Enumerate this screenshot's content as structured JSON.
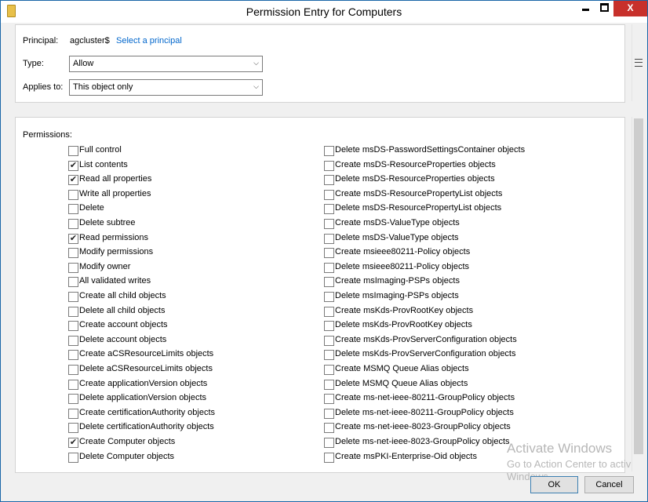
{
  "window": {
    "title": "Permission Entry for Computers",
    "close_glyph": "X"
  },
  "principal": {
    "label": "Principal:",
    "value": "agcluster$",
    "link": "Select a principal"
  },
  "type": {
    "label": "Type:",
    "value": "Allow"
  },
  "applies_to": {
    "label": "Applies to:",
    "value": "This object only"
  },
  "permissions": {
    "label": "Permissions:",
    "left": [
      {
        "label": "Full control",
        "checked": false
      },
      {
        "label": "List contents",
        "checked": true
      },
      {
        "label": "Read all properties",
        "checked": true
      },
      {
        "label": "Write all properties",
        "checked": false
      },
      {
        "label": "Delete",
        "checked": false
      },
      {
        "label": "Delete subtree",
        "checked": false
      },
      {
        "label": "Read permissions",
        "checked": true
      },
      {
        "label": "Modify permissions",
        "checked": false
      },
      {
        "label": "Modify owner",
        "checked": false
      },
      {
        "label": "All validated writes",
        "checked": false
      },
      {
        "label": "Create all child objects",
        "checked": false
      },
      {
        "label": "Delete all child objects",
        "checked": false
      },
      {
        "label": "Create account objects",
        "checked": false
      },
      {
        "label": "Delete account objects",
        "checked": false
      },
      {
        "label": "Create aCSResourceLimits objects",
        "checked": false
      },
      {
        "label": "Delete aCSResourceLimits objects",
        "checked": false
      },
      {
        "label": "Create applicationVersion objects",
        "checked": false
      },
      {
        "label": "Delete applicationVersion objects",
        "checked": false
      },
      {
        "label": "Create certificationAuthority objects",
        "checked": false
      },
      {
        "label": "Delete certificationAuthority objects",
        "checked": false
      },
      {
        "label": "Create Computer objects",
        "checked": true
      },
      {
        "label": "Delete Computer objects",
        "checked": false
      }
    ],
    "right": [
      {
        "label": "Delete msDS-PasswordSettingsContainer objects",
        "checked": false
      },
      {
        "label": "Create msDS-ResourceProperties objects",
        "checked": false
      },
      {
        "label": "Delete msDS-ResourceProperties objects",
        "checked": false
      },
      {
        "label": "Create msDS-ResourcePropertyList objects",
        "checked": false
      },
      {
        "label": "Delete msDS-ResourcePropertyList objects",
        "checked": false
      },
      {
        "label": "Create msDS-ValueType objects",
        "checked": false
      },
      {
        "label": "Delete msDS-ValueType objects",
        "checked": false
      },
      {
        "label": "Create msieee80211-Policy objects",
        "checked": false
      },
      {
        "label": "Delete msieee80211-Policy objects",
        "checked": false
      },
      {
        "label": "Create msImaging-PSPs objects",
        "checked": false
      },
      {
        "label": "Delete msImaging-PSPs objects",
        "checked": false
      },
      {
        "label": "Create msKds-ProvRootKey objects",
        "checked": false
      },
      {
        "label": "Delete msKds-ProvRootKey objects",
        "checked": false
      },
      {
        "label": "Create msKds-ProvServerConfiguration objects",
        "checked": false
      },
      {
        "label": "Delete msKds-ProvServerConfiguration objects",
        "checked": false
      },
      {
        "label": "Create MSMQ Queue Alias objects",
        "checked": false
      },
      {
        "label": "Delete MSMQ Queue Alias objects",
        "checked": false
      },
      {
        "label": "Create ms-net-ieee-80211-GroupPolicy objects",
        "checked": false
      },
      {
        "label": "Delete ms-net-ieee-80211-GroupPolicy objects",
        "checked": false
      },
      {
        "label": "Create ms-net-ieee-8023-GroupPolicy objects",
        "checked": false
      },
      {
        "label": "Delete ms-net-ieee-8023-GroupPolicy objects",
        "checked": false
      },
      {
        "label": "Create msPKI-Enterprise-Oid objects",
        "checked": false
      }
    ]
  },
  "watermark": {
    "line1": "Activate Windows",
    "line2": "Go to Action Center to activ",
    "line3": "Windows."
  },
  "buttons": {
    "ok": "OK",
    "cancel": "Cancel"
  },
  "colors": {
    "link": "#0066cc",
    "close": "#c7302b",
    "border_accent": "#1a67a8"
  }
}
